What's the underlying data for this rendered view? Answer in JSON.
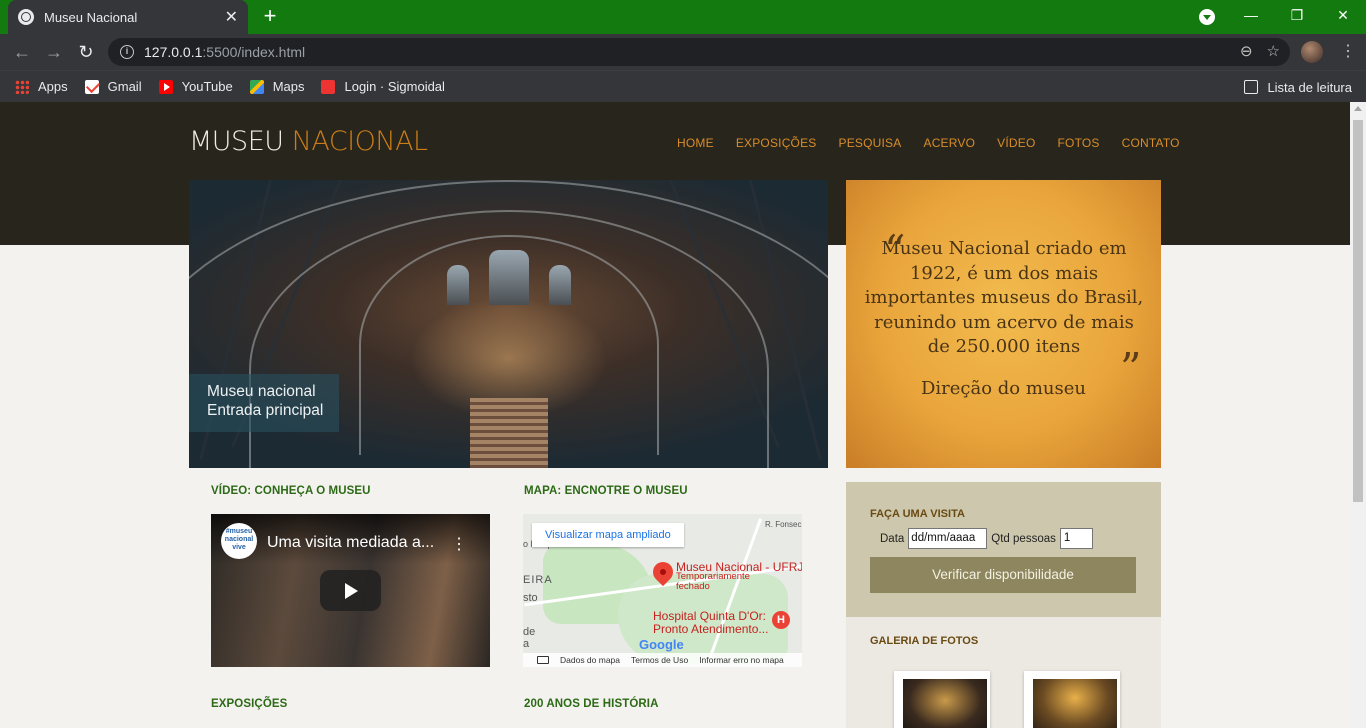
{
  "browser": {
    "tab_title": "Museu Nacional",
    "url_host": "127.0.0.1",
    "url_rest": ":5500/index.html",
    "bookmarks": [
      "Apps",
      "Gmail",
      "YouTube",
      "Maps",
      "Login · Sigmoidal"
    ],
    "reading_list": "Lista de leitura"
  },
  "site": {
    "logo_part1": "MUSEU",
    "logo_part2": "NACIONAL",
    "nav": [
      "HOME",
      "EXPOSIÇÕES",
      "PESQUISA",
      "ACERVO",
      "VÍDEO",
      "FOTOS",
      "CONTATO"
    ],
    "hero_caption_line1": "Museu nacional",
    "hero_caption_line2": "Entrada principal",
    "quote_text": "Museu Nacional criado em 1922, é um dos mais importantes museus do Brasil, reunindo um acervo de mais de 250.000 itens",
    "quote_author": "Direção do museu",
    "video_title": "VÍDEO: CONHEÇA O MUSEU",
    "video_name": "Uma visita mediada a...",
    "channel_badge": "#museu nacional vive",
    "map_title": "MAPA: ENCNOTRE O MUSEU",
    "map_open_link": "Visualizar mapa ampliado",
    "map_place": "Museu Nacional - UFRJ",
    "map_status": "Temporariamente fechado",
    "map_hospital_line1": "Hospital Quinta D'Or:",
    "map_hospital_line2": "Pronto Atendimento...",
    "map_labels": [
      "R. Fonsec",
      "o Parque do Rio",
      "EIRA",
      "sto",
      "de",
      "a"
    ],
    "map_footer": [
      "Dados do mapa",
      "Termos de Uso",
      "Informar erro no mapa"
    ],
    "map_brand": "Google",
    "exposicoes_title": "EXPOSIÇÕES",
    "historia_title": "200 ANOS DE HISTÓRIA",
    "visit_title": "FAÇA UMA VISITA",
    "visit_date_label": "Data",
    "visit_date_value": "dd/mm/aaaa",
    "visit_qty_label": "Qtd pessoas",
    "visit_qty_value": "1",
    "visit_button": "Verificar disponibilidade",
    "gallery_title": "GALERIA DE FOTOS"
  }
}
